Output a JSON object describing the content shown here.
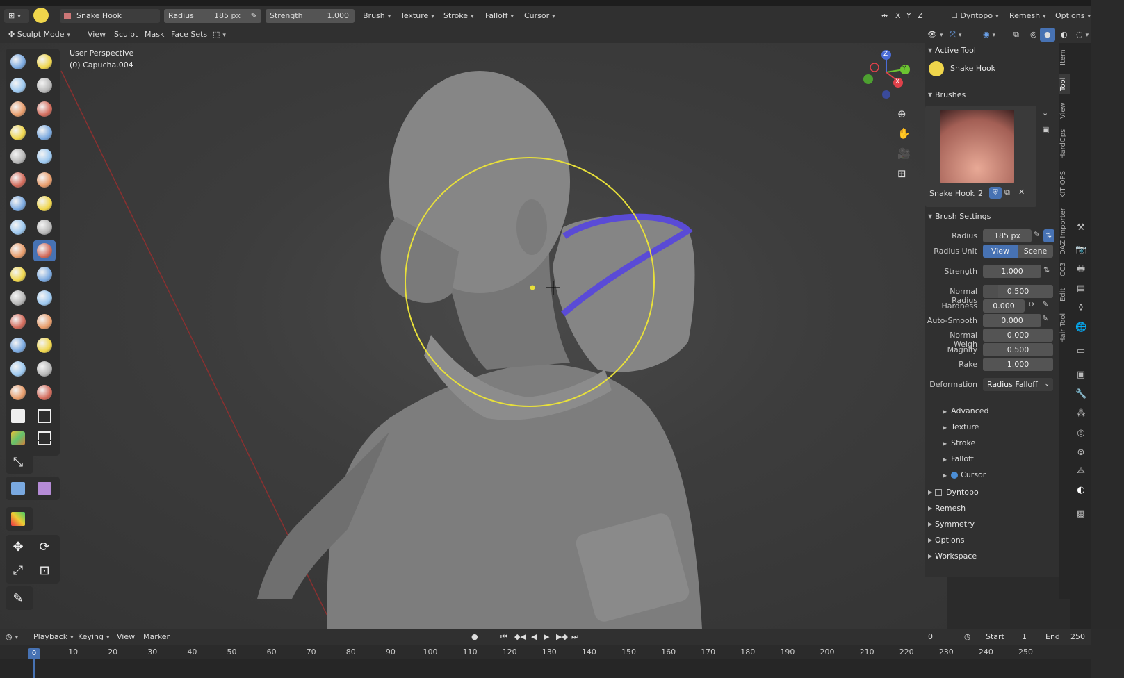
{
  "header": {
    "brush_name": "Snake Hook",
    "radius_label": "Radius",
    "radius_value": "185 px",
    "strength_label": "Strength",
    "strength_value": "1.000",
    "menus": [
      "Brush",
      "Texture",
      "Stroke",
      "Falloff",
      "Cursor"
    ],
    "axes": [
      "X",
      "Y",
      "Z"
    ],
    "dyntopo": "Dyntopo",
    "remesh": "Remesh",
    "options": "Options"
  },
  "mode_bar": {
    "mode": "Sculpt Mode",
    "menus": [
      "View",
      "Sculpt",
      "Mask",
      "Face Sets"
    ]
  },
  "viewport": {
    "perspective": "User Perspective",
    "object": "(0) Capucha.004",
    "gizmo_axes": [
      "Z",
      "Y",
      "X"
    ]
  },
  "tool_panel": {
    "active_tool_title": "Active Tool",
    "active_tool_name": "Snake Hook",
    "brushes_title": "Brushes",
    "brush_name": "Snake Hook",
    "brush_users": "2",
    "brush_settings_title": "Brush Settings",
    "radius_label": "Radius",
    "radius_value": "185 px",
    "radius_unit_label": "Radius Unit",
    "radius_unit_view": "View",
    "radius_unit_scene": "Scene",
    "strength_label": "Strength",
    "strength_value": "1.000",
    "normal_radius_label": "Normal Radius",
    "normal_radius_value": "0.500",
    "hardness_label": "Hardness",
    "hardness_value": "0.000",
    "auto_smooth_label": "Auto-Smooth",
    "auto_smooth_value": "0.000",
    "normal_weight_label": "Normal Weigh",
    "normal_weight_value": "0.000",
    "magnify_label": "Magnify",
    "magnify_value": "0.500",
    "rake_label": "Rake",
    "rake_value": "1.000",
    "deformation_label": "Deformation",
    "deformation_value": "Radius Falloff",
    "subpanels": [
      "Advanced",
      "Texture",
      "Stroke",
      "Falloff",
      "Cursor"
    ],
    "panels": [
      "Dyntopo",
      "Remesh",
      "Symmetry",
      "Options",
      "Workspace"
    ]
  },
  "vertical_tabs": [
    "Item",
    "Tool",
    "View",
    "HardOps",
    "KIT OPS",
    "DAZ Importer",
    "CC3",
    "Edit",
    "Hair Tool"
  ],
  "timeline": {
    "menus": [
      "Playback",
      "Keying",
      "View",
      "Marker"
    ],
    "current_frame": "0",
    "start_label": "Start",
    "start_value": "1",
    "end_label": "End",
    "end_value": "250",
    "playhead": "0",
    "ruler": [
      "10",
      "20",
      "30",
      "40",
      "50",
      "60",
      "70",
      "80",
      "90",
      "100",
      "110",
      "120",
      "130",
      "140",
      "150",
      "160",
      "170",
      "180",
      "190",
      "200",
      "210",
      "220",
      "230",
      "240",
      "250"
    ]
  },
  "colors": {
    "accent": "#4772b3",
    "brush_circle": "#e8e03a",
    "hood_edge": "#5a4bd6",
    "axis_x": "#e0414a",
    "axis_y": "#6cc431",
    "axis_z": "#4b6cd6"
  }
}
